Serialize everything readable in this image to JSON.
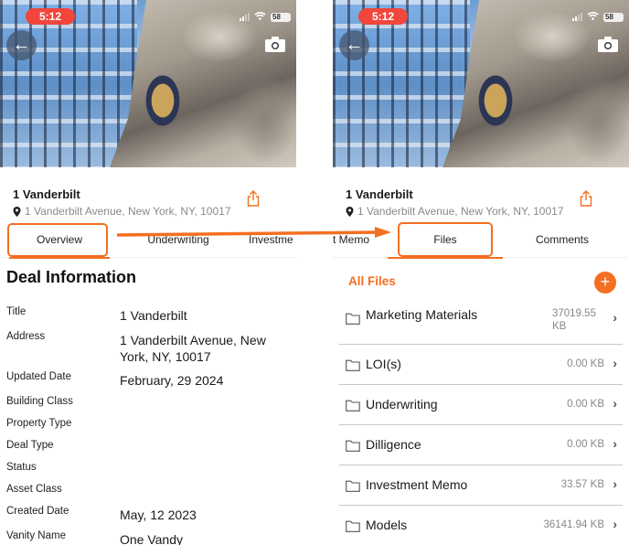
{
  "status_bar": {
    "time": "5:12",
    "battery": "58"
  },
  "deal": {
    "title": "1 Vanderbilt",
    "address": "1 Vanderbilt Avenue, New York, NY, 10017"
  },
  "left_tabs": [
    {
      "label": "Overview",
      "active": true
    },
    {
      "label": "Underwriting",
      "active": false
    },
    {
      "label": "Investme",
      "active": false
    }
  ],
  "right_tabs": [
    {
      "label": "t Memo",
      "active": false
    },
    {
      "label": "Files",
      "active": true
    },
    {
      "label": "Comments",
      "active": false
    }
  ],
  "deal_information": {
    "heading": "Deal Information",
    "rows": [
      {
        "label": "Title",
        "value": "1 Vanderbilt"
      },
      {
        "label": "Address",
        "value": "1 Vanderbilt Avenue, New York, NY, 10017"
      },
      {
        "label": "Updated Date",
        "value": "February, 29 2024"
      },
      {
        "label": "Building Class",
        "value": ""
      },
      {
        "label": "Property Type",
        "value": ""
      },
      {
        "label": "Deal Type",
        "value": ""
      },
      {
        "label": "Status",
        "value": ""
      },
      {
        "label": "Asset Class",
        "value": ""
      },
      {
        "label": "Created Date",
        "value": "May, 12 2023"
      },
      {
        "label": "Vanity Name",
        "value": "One Vandy"
      }
    ]
  },
  "files": {
    "heading": "All Files",
    "add_label": "+",
    "folders": [
      {
        "name": "Marketing Materials",
        "size": "37019.55 KB"
      },
      {
        "name": "LOI(s)",
        "size": "0.00 KB"
      },
      {
        "name": "Underwriting",
        "size": "0.00 KB"
      },
      {
        "name": "Dilligence",
        "size": "0.00 KB"
      },
      {
        "name": "Investment Memo",
        "size": "33.57 KB"
      },
      {
        "name": "Models",
        "size": "36141.94 KB"
      }
    ]
  },
  "icons": {
    "back": "←",
    "chevron": "›",
    "wifi": "wifi-icon",
    "camera": "camera-icon",
    "share": "share-icon",
    "pin": "location-pin-icon",
    "folder": "folder-icon"
  },
  "colors": {
    "accent": "#f36f21",
    "status_time_bg": "#f0463c",
    "muted_text": "#888888"
  }
}
